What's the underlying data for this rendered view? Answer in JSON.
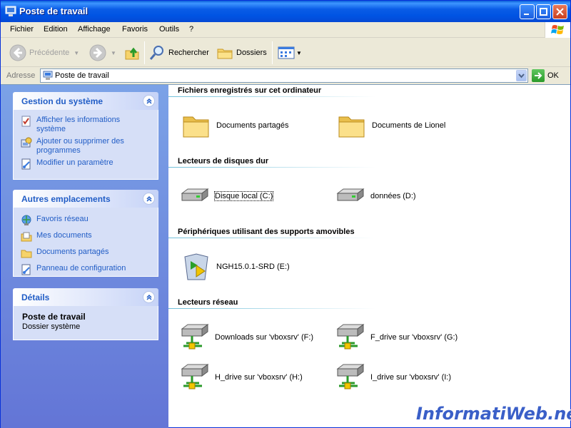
{
  "window": {
    "title": "Poste de travail"
  },
  "menubar": {
    "items": [
      "Fichier",
      "Edition",
      "Affichage",
      "Favoris",
      "Outils",
      "?"
    ]
  },
  "toolbar": {
    "back_label": "Précédente",
    "search_label": "Rechercher",
    "folders_label": "Dossiers"
  },
  "address": {
    "label": "Adresse",
    "value": "Poste de travail",
    "go_label": "OK"
  },
  "taskpane": {
    "system": {
      "title": "Gestion du système",
      "tasks": [
        {
          "label": "Afficher les informations système",
          "icon": "system-info-icon"
        },
        {
          "label": "Ajouter ou supprimer des programmes",
          "icon": "add-remove-programs-icon"
        },
        {
          "label": "Modifier un paramètre",
          "icon": "control-panel-icon"
        }
      ]
    },
    "places": {
      "title": "Autres emplacements",
      "tasks": [
        {
          "label": "Favoris réseau",
          "icon": "network-places-icon"
        },
        {
          "label": "Mes documents",
          "icon": "my-documents-icon"
        },
        {
          "label": "Documents partagés",
          "icon": "shared-documents-icon"
        },
        {
          "label": "Panneau de configuration",
          "icon": "control-panel-icon"
        }
      ]
    },
    "details": {
      "title": "Détails",
      "name": "Poste de travail",
      "type": "Dossier système"
    }
  },
  "sections": [
    {
      "title": "Fichiers enregistrés sur cet ordinateur",
      "items": [
        {
          "label": "Documents partagés",
          "icon": "folder-icon"
        },
        {
          "label": "Documents de Lionel",
          "icon": "folder-icon"
        }
      ]
    },
    {
      "title": "Lecteurs de disques dur",
      "items": [
        {
          "label": "Disque local (C:)",
          "icon": "hard-drive-icon"
        },
        {
          "label": "données (D:)",
          "icon": "hard-drive-icon"
        }
      ]
    },
    {
      "title": "Périphériques utilisant des supports amovibles",
      "items": [
        {
          "label": "NGH15.0.1-SRD (E:)",
          "icon": "cd-autorun-icon"
        }
      ]
    },
    {
      "title": "Lecteurs réseau",
      "items": [
        {
          "label": "Downloads sur 'vboxsrv' (F:)",
          "icon": "network-drive-icon"
        },
        {
          "label": "F_drive sur 'vboxsrv' (G:)",
          "icon": "network-drive-icon"
        },
        {
          "label": "H_drive sur 'vboxsrv' (H:)",
          "icon": "network-drive-icon"
        },
        {
          "label": "I_drive sur 'vboxsrv' (I:)",
          "icon": "network-drive-icon"
        }
      ]
    }
  ],
  "watermark": "InformatiWeb.net",
  "colors": {
    "titlebar": "#0054e3",
    "taskpane": "#6f8de0",
    "link": "#215dc6"
  }
}
